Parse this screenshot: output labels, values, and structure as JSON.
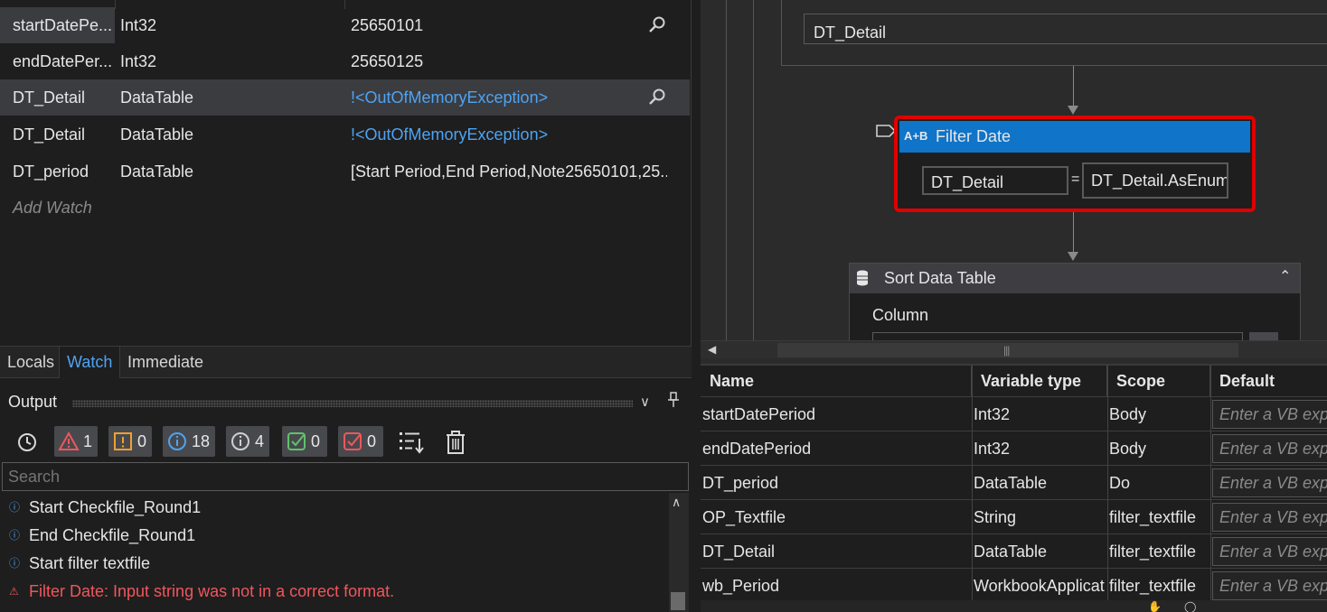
{
  "watch": {
    "rows": [
      {
        "name": "startDatePe...",
        "type": "Int32",
        "value": "25650101"
      },
      {
        "name": "endDatePer...",
        "type": "Int32",
        "value": "25650125"
      },
      {
        "name": "DT_Detail",
        "type": "DataTable",
        "value": "!<OutOfMemoryException>"
      },
      {
        "name": "DT_Detail",
        "type": "DataTable",
        "value": "!<OutOfMemoryException>"
      },
      {
        "name": "DT_period",
        "type": "DataTable",
        "value": "[Start Period,End Period,Note25650101,25..."
      }
    ],
    "add_watch": "Add Watch"
  },
  "tabs": [
    {
      "label": "Locals"
    },
    {
      "label": "Watch",
      "active": true
    },
    {
      "label": "Immediate"
    }
  ],
  "output": {
    "title": "Output",
    "filters": {
      "error_count": "1",
      "warning_count": "0",
      "info_count": "18",
      "trace_count": "4",
      "success_count": "0",
      "fail_count": "0"
    },
    "search_placeholder": "Search",
    "log": [
      {
        "text": "Start Checkfile_Round1",
        "level": "info"
      },
      {
        "text": "End Checkfile_Round1",
        "level": "info"
      },
      {
        "text": "Start filter textfile",
        "level": "info"
      },
      {
        "text": "Filter Date: Input string was not in a correct format.",
        "level": "error"
      }
    ]
  },
  "designer": {
    "top_field": "DT_Detail",
    "assign": {
      "icon_text": "A+B",
      "title": "Filter Date",
      "lhs": "DT_Detail",
      "eq": "=",
      "rhs": "DT_Detail.AsEnumerable"
    },
    "sort": {
      "title": "Sort Data Table",
      "column_label": "Column"
    }
  },
  "variables": {
    "headers": {
      "name": "Name",
      "type": "Variable type",
      "scope": "Scope",
      "default": "Default"
    },
    "rows": [
      {
        "name": "startDatePeriod",
        "type": "Int32",
        "scope": "Body",
        "default": "Enter a VB expr"
      },
      {
        "name": "endDatePeriod",
        "type": "Int32",
        "scope": "Body",
        "default": "Enter a VB expr"
      },
      {
        "name": "DT_period",
        "type": "DataTable",
        "scope": "Do",
        "default": "Enter a VB expr"
      },
      {
        "name": "OP_Textfile",
        "type": "String",
        "scope": "filter_textfile",
        "default": "Enter a VB expr"
      },
      {
        "name": "DT_Detail",
        "type": "DataTable",
        "scope": "filter_textfile",
        "default": "Enter a VB expr"
      },
      {
        "name": "wb_Period",
        "type": "WorkbookApplicat",
        "scope": "filter_textfile",
        "default": "Enter a VB expr"
      }
    ]
  },
  "colors": {
    "accent": "#4ea3f2",
    "assign_header": "#1074c8",
    "highlight_border": "#e00000",
    "error_text": "#f0565c"
  }
}
